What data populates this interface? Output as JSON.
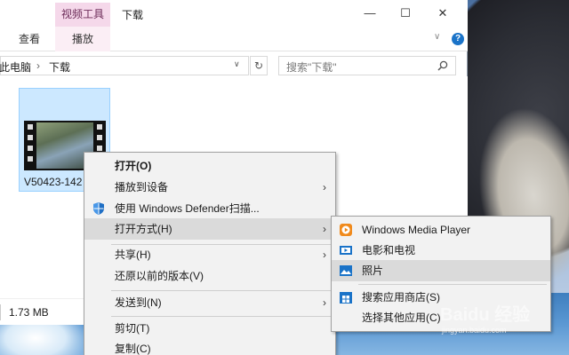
{
  "window": {
    "title": "下载",
    "context_tab_header": "视频工具",
    "minimize_glyph": "—",
    "maximize_glyph": "☐",
    "close_glyph": "✕"
  },
  "ribbon": {
    "tabs": [
      "查看",
      "播放"
    ],
    "help_glyph": "?",
    "collapse_glyph": "∨"
  },
  "address": {
    "crumbs": [
      "此电脑",
      "下载"
    ],
    "separator": "›",
    "dropdown_glyph": "∨",
    "refresh_glyph": "↻"
  },
  "search": {
    "placeholder": "搜索\"下载\""
  },
  "file": {
    "name": "V50423-142"
  },
  "status": {
    "size": "1.73 MB"
  },
  "context_menu": {
    "items": [
      {
        "label": "打开(O)",
        "bold": true
      },
      {
        "label": "播放到设备",
        "submenu": true
      },
      {
        "label": "使用 Windows Defender扫描...",
        "icon": "shield-icon"
      },
      {
        "label": "打开方式(H)",
        "submenu": true,
        "highlighted": true
      },
      {
        "label": "共享(H)",
        "submenu": true
      },
      {
        "label": "还原以前的版本(V)"
      },
      {
        "label": "发送到(N)",
        "submenu": true
      },
      {
        "label": "剪切(T)"
      },
      {
        "label": "复制(C)"
      }
    ]
  },
  "submenu": {
    "items": [
      {
        "label": "Windows Media Player",
        "icon": "media-player-icon"
      },
      {
        "label": "电影和电视",
        "icon": "movies-tv-icon"
      },
      {
        "label": "照片",
        "icon": "photos-icon",
        "highlighted": true
      },
      {
        "label": "搜索应用商店(S)",
        "icon": "store-icon"
      },
      {
        "label": "选择其他应用(C)"
      }
    ]
  },
  "watermark": {
    "main": "Baidu 经验",
    "sub": "jingyan.baidu.com"
  },
  "colors": {
    "accent": "#1a73c8",
    "highlight": "#dadada",
    "selection": "#cce8ff",
    "context_tab": "#f5d8ea"
  }
}
